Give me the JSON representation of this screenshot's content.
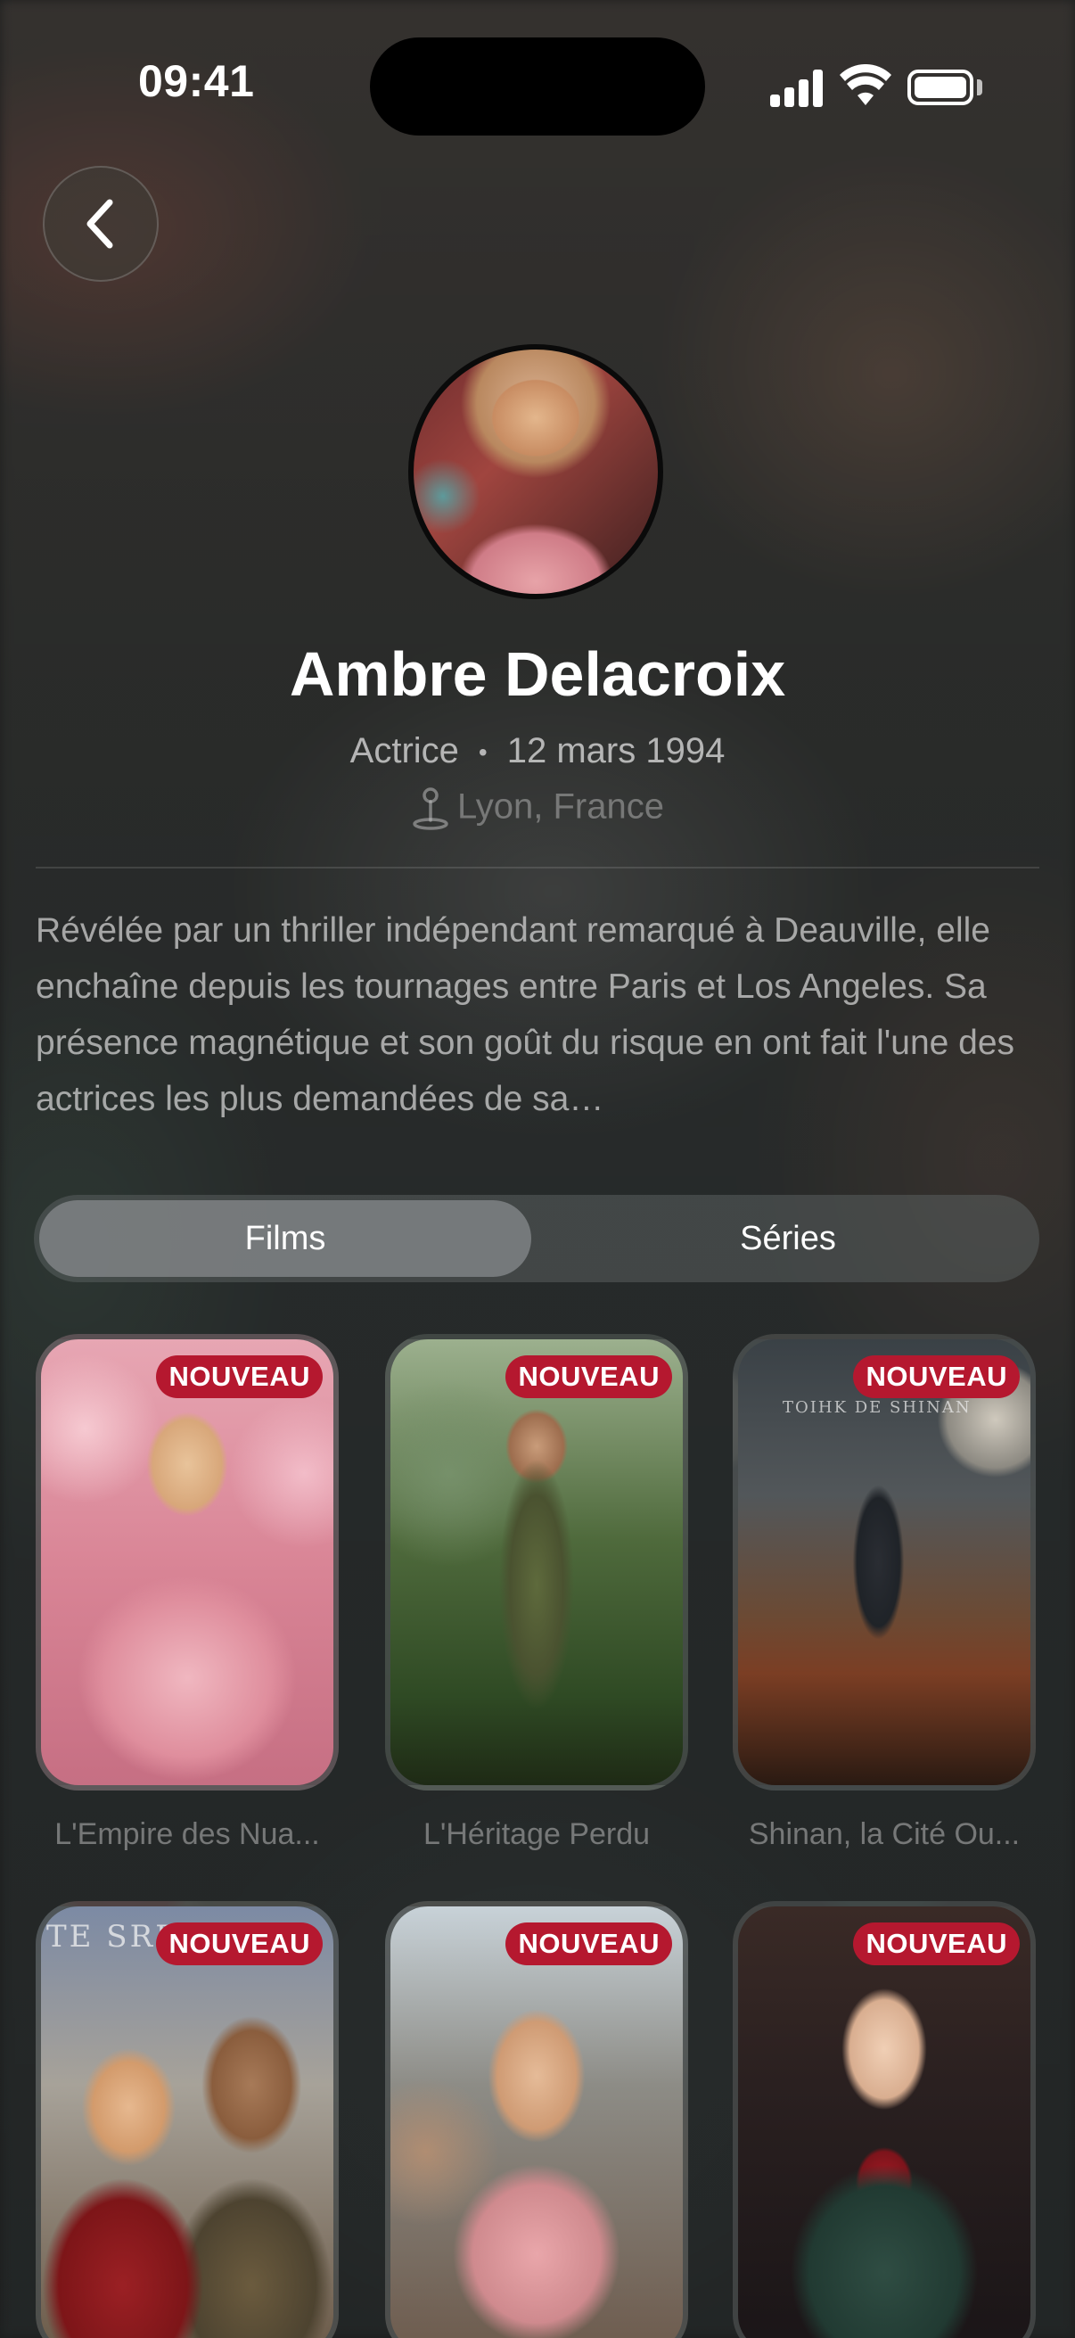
{
  "status_bar": {
    "time": "09:41"
  },
  "profile": {
    "name": "Ambre Delacroix",
    "role": "Actrice",
    "separator": "•",
    "birth_date": "12 mars 1994",
    "location": "Lyon, France",
    "bio": "Révélée par un thriller indépendant remarqué à Deauville, elle enchaîne depuis les tournages entre Paris et Los Angeles. Sa présence magnétique et son goût du risque en ont fait l'une des actrices les plus demandées de sa…"
  },
  "tabs": [
    {
      "label": "Films",
      "selected": true
    },
    {
      "label": "Séries",
      "selected": false
    }
  ],
  "badge_label": "NOUVEAU",
  "posters": [
    {
      "title": "L'Empire des Nua...",
      "art_text": ""
    },
    {
      "title": "L'Héritage Perdu",
      "art_text": ""
    },
    {
      "title": "Shinan, la Cité Ou...",
      "art_text": "TOIHK DE SHINAN"
    },
    {
      "title": "",
      "art_text": "TE SRD"
    },
    {
      "title": "",
      "art_text": ""
    },
    {
      "title": "",
      "art_text": ""
    }
  ],
  "colors": {
    "badge": "#b5182f",
    "accent_text": "#ffffff"
  }
}
